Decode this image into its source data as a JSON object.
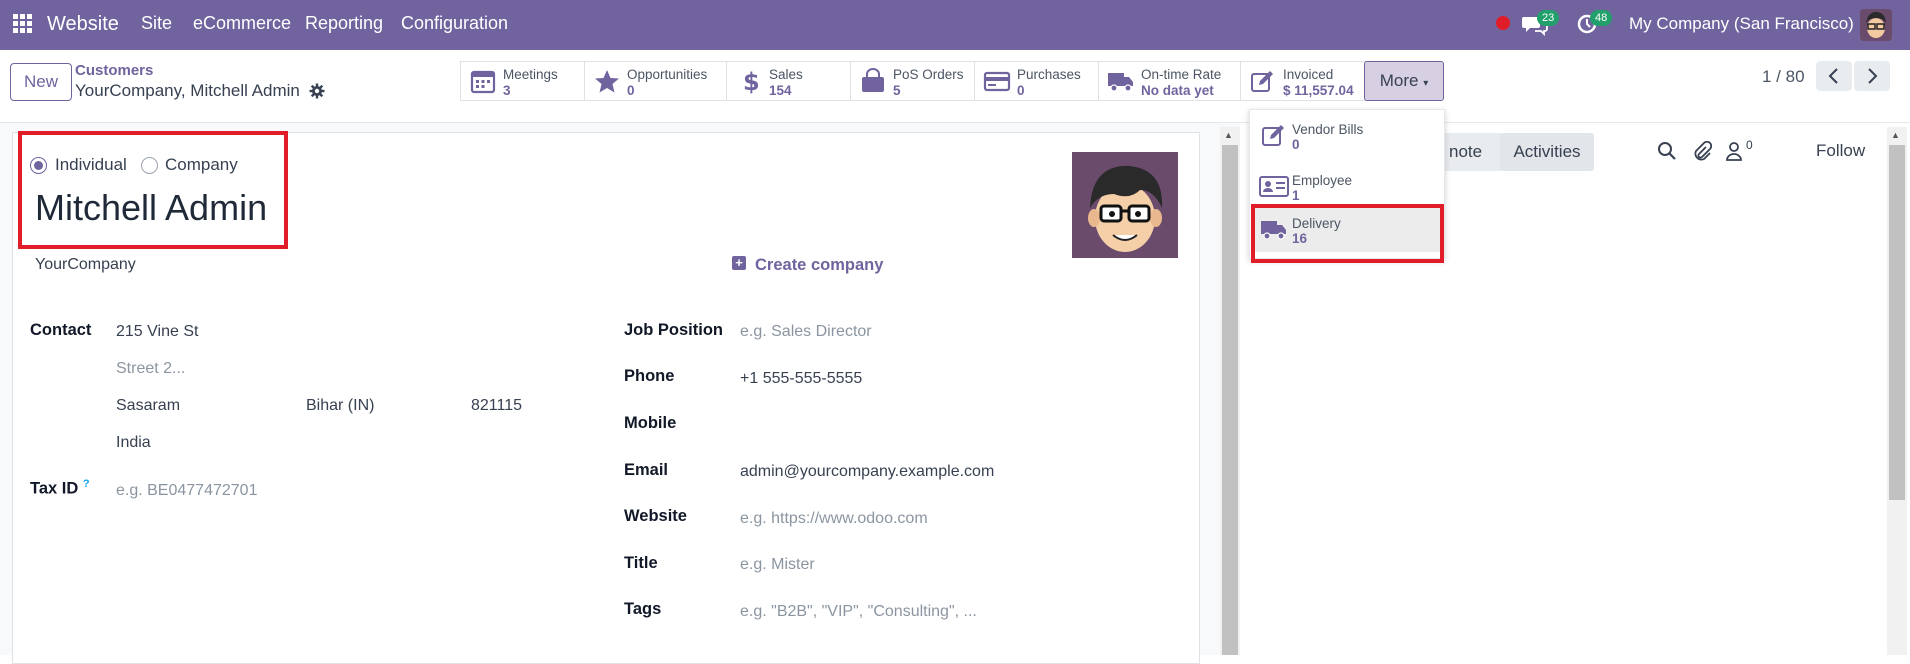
{
  "topbar": {
    "app_name": "Website",
    "menu": [
      "Site",
      "eCommerce",
      "Reporting",
      "Configuration"
    ],
    "messages_count": "23",
    "activities_count": "48",
    "company": "My Company (San Francisco)"
  },
  "control": {
    "new_label": "New",
    "breadcrumb_parent": "Customers",
    "breadcrumb_current": "YourCompany, Mitchell Admin",
    "smart_buttons": [
      {
        "label": "Meetings",
        "value": "3",
        "icon": "calendar-icon"
      },
      {
        "label": "Opportunities",
        "value": "0",
        "icon": "star-icon"
      },
      {
        "label": "Sales",
        "value": "154",
        "icon": "dollar-icon"
      },
      {
        "label": "PoS Orders",
        "value": "5",
        "icon": "shopping-bag-icon"
      },
      {
        "label": "Purchases",
        "value": "0",
        "icon": "credit-card-icon"
      },
      {
        "label": "On-time Rate",
        "value": "No data yet",
        "icon": "truck-icon"
      },
      {
        "label": "Invoiced",
        "value": "$ 11,557.04",
        "icon": "pencil-square-icon"
      }
    ],
    "more_label": "More",
    "pager": "1 / 80"
  },
  "dropdown": {
    "items": [
      {
        "label": "Vendor Bills",
        "value": "0",
        "icon": "pencil-square-icon"
      },
      {
        "label": "Employee",
        "value": "1",
        "icon": "id-card-icon"
      },
      {
        "label": "Delivery",
        "value": "16",
        "icon": "truck-icon"
      }
    ]
  },
  "form": {
    "type_options": [
      "Individual",
      "Company"
    ],
    "name": "Mitchell Admin",
    "parent_company": "YourCompany",
    "create_company": "Create company",
    "contact_label": "Contact",
    "street": "215 Vine St",
    "street2_placeholder": "Street 2...",
    "city": "Sasaram",
    "state": "Bihar (IN)",
    "zip": "821115",
    "country": "India",
    "tax_label": "Tax ID",
    "tax_help": "?",
    "tax_placeholder": "e.g. BE0477472701",
    "job_label": "Job Position",
    "job_placeholder": "e.g. Sales Director",
    "phone_label": "Phone",
    "phone": "+1 555-555-5555",
    "mobile_label": "Mobile",
    "email_label": "Email",
    "email": "admin@yourcompany.example.com",
    "website_label": "Website",
    "website_placeholder": "e.g. https://www.odoo.com",
    "title_label": "Title",
    "title_placeholder": "e.g. Mister",
    "tags_label": "Tags",
    "tags_placeholder": "e.g. \"B2B\", \"VIP\", \"Consulting\", ..."
  },
  "chatter": {
    "note_label": "note",
    "activities_label": "Activities",
    "followers_count": "0",
    "follow_label": "Follow"
  },
  "colors": {
    "brand": "#71639e",
    "highlight": "#e11d2a",
    "badge": "#22a06b"
  }
}
